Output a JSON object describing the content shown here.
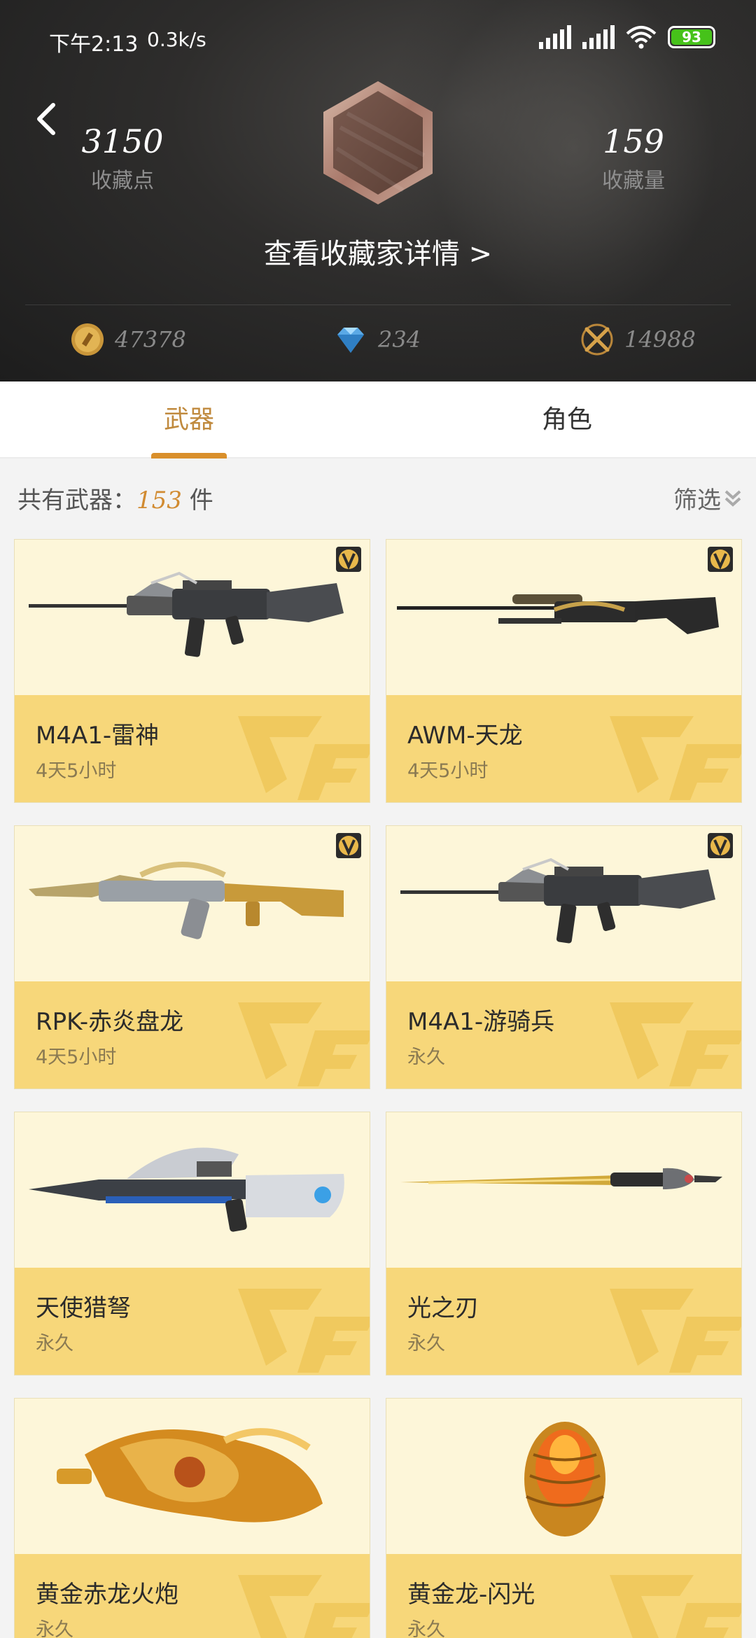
{
  "status_bar": {
    "time": "下午2:13",
    "speed": "0.3k/s",
    "battery": "93"
  },
  "header": {
    "points_value": "3150",
    "points_label": "收藏点",
    "count_value": "159",
    "count_label": "收藏量",
    "detail_link": "查看收藏家详情 >",
    "currencies": [
      {
        "icon": "gold-coin-icon",
        "value": "47378"
      },
      {
        "icon": "diamond-icon",
        "value": "234"
      },
      {
        "icon": "crossed-swords-icon",
        "value": "14988"
      }
    ]
  },
  "tabs": [
    {
      "label": "武器",
      "active": true
    },
    {
      "label": "角色",
      "active": false
    }
  ],
  "summary": {
    "prefix": "共有武器：",
    "count": "153",
    "suffix": " 件",
    "filter_label": "筛选"
  },
  "colors": {
    "accent": "#d98f2b",
    "card_bg": "#fdf6d9",
    "card_info": "#f7d77a",
    "battery": "#46c21a"
  },
  "weapons": [
    {
      "name": "M4A1-雷神",
      "duration": "4天5小时",
      "vip": true,
      "art": "rifle"
    },
    {
      "name": "AWM-天龙",
      "duration": "4天5小时",
      "vip": true,
      "art": "sniper"
    },
    {
      "name": "RPK-赤炎盘龙",
      "duration": "4天5小时",
      "vip": true,
      "art": "lmg"
    },
    {
      "name": "M4A1-游骑兵",
      "duration": "永久",
      "vip": true,
      "art": "rifle"
    },
    {
      "name": "天使猎弩",
      "duration": "永久",
      "vip": false,
      "art": "crossbow"
    },
    {
      "name": "光之刃",
      "duration": "永久",
      "vip": false,
      "art": "blade"
    },
    {
      "name": "黄金赤龙火炮",
      "duration": "永久",
      "vip": false,
      "art": "cannon"
    },
    {
      "name": "黄金龙-闪光",
      "duration": "永久",
      "vip": false,
      "art": "egg"
    }
  ]
}
